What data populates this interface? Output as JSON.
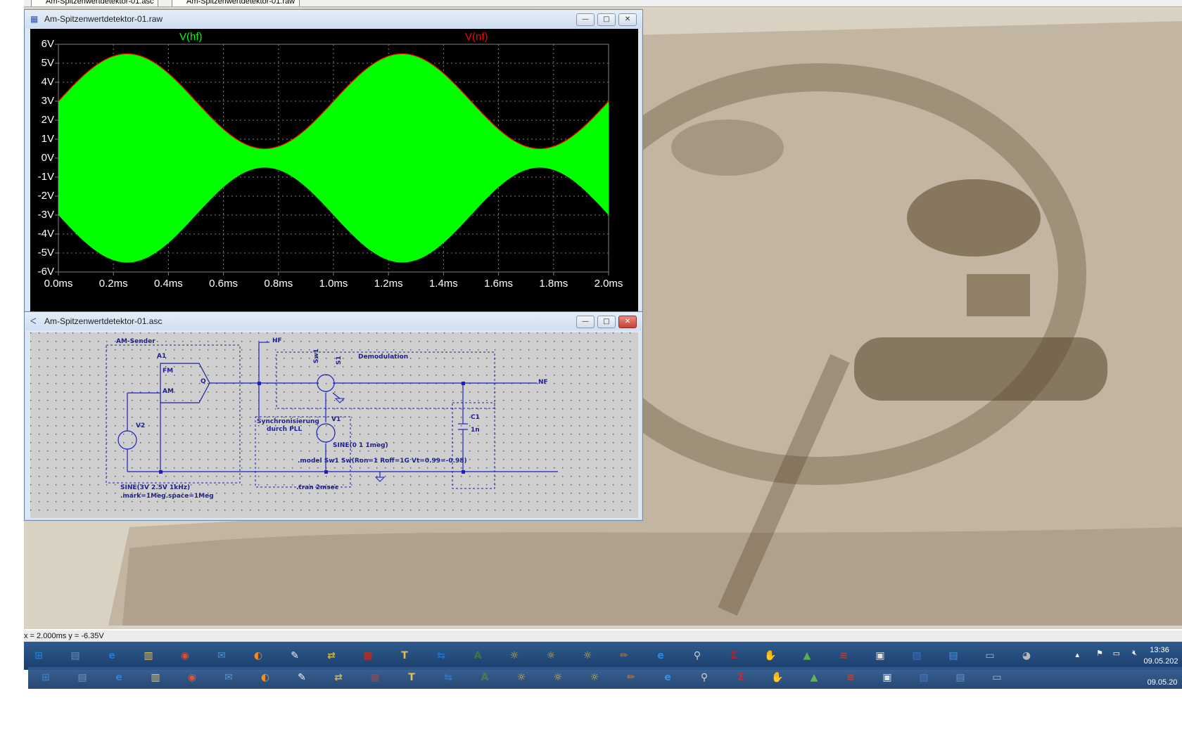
{
  "mdi_tabs": [
    {
      "label": "Am-Spitzenwertdetektor-01.asc"
    },
    {
      "label": "Am-Spitzenwertdetektor-01.raw"
    }
  ],
  "plot_window": {
    "title": "Am-Spitzenwertdetektor-01.raw",
    "btn_min": "—",
    "btn_max": "□",
    "btn_close": "✕",
    "trace_hf": "V(hf)",
    "trace_nf": "V(nf)",
    "hf_color": "#00ff00",
    "nf_color": "#ff0000",
    "yticks": [
      "6V",
      "5V",
      "4V",
      "3V",
      "2V",
      "1V",
      "0V",
      "-1V",
      "-2V",
      "-3V",
      "-4V",
      "-5V",
      "-6V"
    ],
    "xticks": [
      "0.0ms",
      "0.2ms",
      "0.4ms",
      "0.6ms",
      "0.8ms",
      "1.0ms",
      "1.2ms",
      "1.4ms",
      "1.6ms",
      "1.8ms",
      "2.0ms"
    ]
  },
  "chart_data": {
    "type": "area",
    "title": "",
    "xlabel": "",
    "ylabel": "",
    "xlim": [
      0,
      2.0
    ],
    "ylim": [
      -6,
      6
    ],
    "x_unit": "ms",
    "y_unit": "V",
    "series": [
      {
        "name": "V(hf)",
        "description": "AM carrier 1MHz filled envelope",
        "x": [
          0.0,
          0.2,
          0.4,
          0.6,
          0.75,
          0.8,
          1.0,
          1.25,
          1.4,
          1.6,
          1.75,
          1.8,
          2.0
        ],
        "upper": [
          3.0,
          5.4,
          4.6,
          1.5,
          0.5,
          0.6,
          2.9,
          5.5,
          4.7,
          1.4,
          0.5,
          0.6,
          2.9
        ],
        "lower": [
          -3.0,
          -5.4,
          -4.6,
          -1.5,
          -0.5,
          -0.6,
          -2.9,
          -5.5,
          -4.7,
          -1.4,
          -0.5,
          -0.6,
          -2.9
        ]
      },
      {
        "name": "V(nf)",
        "x": [
          0.0,
          0.2,
          0.4,
          0.6,
          0.75,
          0.8,
          1.0,
          1.25,
          1.4,
          1.6,
          1.75,
          1.8,
          2.0
        ],
        "values": [
          3.0,
          5.4,
          4.6,
          1.5,
          0.5,
          0.6,
          2.9,
          5.5,
          4.7,
          1.4,
          0.5,
          0.6,
          2.9
        ]
      }
    ],
    "grid": true
  },
  "schematic_window": {
    "title": "Am-Spitzenwertdetektor-01.asc",
    "btn_min": "—",
    "btn_max": "□",
    "btn_close": "✕",
    "labels": {
      "am_sender": "AM-Sender",
      "a1": "A1",
      "fm": "FM",
      "am": "AM",
      "q": "Q",
      "v2": "V2",
      "hf": "HF",
      "sw1": "Sw1",
      "s1": "S1",
      "demodulation": "Demodulation",
      "nf": "NF",
      "sync1": "Synchronisierung",
      "sync2": "durch PLL",
      "v1": "V1",
      "c1": "C1",
      "c1_value": "1n",
      "v1_value": "SINE(0 1 1meg)",
      "model": ".model Sw1 Sw(Ron=1 Roff=1G Vt=0.99=-0.98)",
      "v2_value": "SINE(3V 2.5V 1kHz)",
      "v2_mark": ".mark=1Meg.space=1Meg",
      "tran": ".tran 2msec"
    }
  },
  "statusbar": {
    "text": "x = 2.000ms    y = -6.35V"
  },
  "taskbar": {
    "time": "13:36",
    "date": "09.05.202",
    "date2": "09.05.20",
    "tray_icons": [
      "show-hidden-icon",
      "flag-icon",
      "network-icon",
      "volume-muted-icon"
    ]
  }
}
